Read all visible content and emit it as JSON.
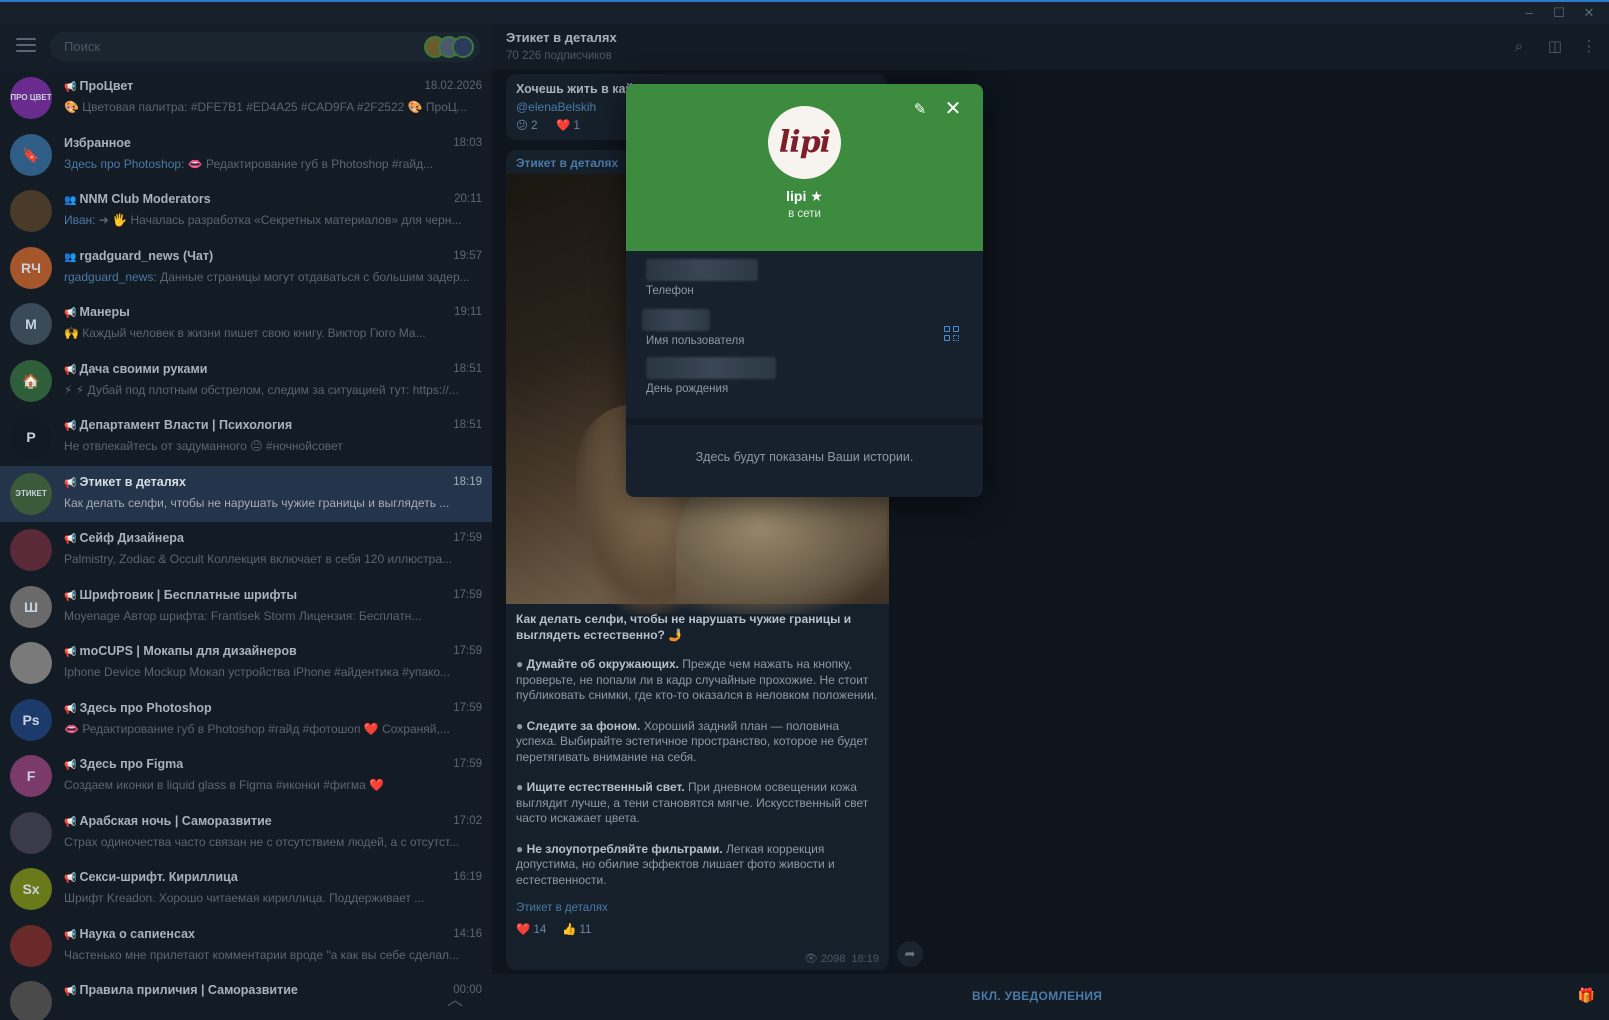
{
  "search": {
    "placeholder": "Поиск"
  },
  "chats": [
    {
      "name": "ПроЦвет",
      "time": "18.02.2026",
      "who": "",
      "preview": "🎨 Цветовая палитра: #DFE7B1 #ED4A25 #CAD9FA #2F2522 🎨 ПроЦ...",
      "avatar_text": "ПРО ЦВЕТ",
      "avatar_color": "#6a2b8e",
      "channel": true
    },
    {
      "name": "Избранное",
      "time": "18:03",
      "who": "Здесь про Photoshop:",
      "preview": " 👄 Редактирование губ в Photoshop #гайд...",
      "avatar_text": "🔖",
      "avatar_color": "#2f5d86",
      "channel": false
    },
    {
      "name": "NNM Club Moderators",
      "time": "20:11",
      "who": "Иван:",
      "preview": " ➜ 🖐 Началась разработка «Секретных материалов» для черн...",
      "avatar_text": "",
      "avatar_color": "#4a3a2a",
      "channel": false,
      "group": true
    },
    {
      "name": "rgadguard_news (Чат)",
      "time": "19:57",
      "who": "rgadguard_news:",
      "preview": " Данные страницы могут отдаваться с большим задер...",
      "avatar_text": "RЧ",
      "avatar_color": "#a5562a",
      "channel": false,
      "group": true
    },
    {
      "name": "Манеры",
      "time": "19:11",
      "who": "",
      "preview": "🙌 Каждый человек в жизни пишет свою книгу. Виктор Гюго Ма...",
      "avatar_text": "M",
      "avatar_color": "#3a4a58",
      "channel": true
    },
    {
      "name": "Дача своими руками",
      "time": "18:51",
      "who": "",
      "preview": "⚡ ⚡ Дубай под плотным обстрелом, следим за ситуацией тут: https://...",
      "avatar_text": "🏠",
      "avatar_color": "#2e5e3a",
      "channel": true
    },
    {
      "name": "Департамент Власти | Психология",
      "time": "18:51",
      "who": "",
      "preview": "Не отвлекайтесь от задуманного 😐 #ночнойсовет",
      "avatar_text": "P",
      "avatar_color": "#111a22",
      "channel": true
    },
    {
      "name": "Этикет в деталях",
      "time": "18:19",
      "who": "",
      "preview": "Как делать селфи, чтобы не нарушать чужие границы и выглядеть ...",
      "avatar_text": "ЭТИКЕТ",
      "avatar_color": "#3a5a3a",
      "channel": true,
      "active": true
    },
    {
      "name": "Сейф Дизайнера",
      "time": "17:59",
      "who": "",
      "preview": "Palmistry, Zodiac & Occult Коллекция включает в себя 120 иллюстра...",
      "avatar_text": "",
      "avatar_color": "#5a2a38",
      "channel": true
    },
    {
      "name": "Шрифтовик | Бесплатные шрифты",
      "time": "17:59",
      "who": "",
      "preview": "Moyenage Автор шрифта: Frantisek Storm Лицензия: Бесплатн...",
      "avatar_text": "Ш",
      "avatar_color": "#6a6a6a",
      "channel": true
    },
    {
      "name": "moCUPS | Мокапы для дизайнеров",
      "time": "17:59",
      "who": "",
      "preview": "Iphone Device Mockup Мокап устройства iPhone #айдентика #упако...",
      "avatar_text": "",
      "avatar_color": "#7a7a7a",
      "channel": true
    },
    {
      "name": "Здесь про Photoshop",
      "time": "17:59",
      "who": "",
      "preview": "👄 Редактирование губ в Photoshop #гайд #фотошоп ❤️ Сохраняй,...",
      "avatar_text": "Ps",
      "avatar_color": "#1c3a6a",
      "channel": true
    },
    {
      "name": "Здесь про Figma",
      "time": "17:59",
      "who": "",
      "preview": "Создаем иконки в liquid glass в Figma #иконки #фигма ❤️",
      "avatar_text": "F",
      "avatar_color": "#7a3a6a",
      "channel": true
    },
    {
      "name": "Арабская ночь | Саморазвитие",
      "time": "17:02",
      "who": "",
      "preview": "Страх одиночества часто связан не с отсутствием людей, а с отсутст...",
      "avatar_text": "",
      "avatar_color": "#3a3a4a",
      "channel": true,
      "prefix": "A"
    },
    {
      "name": "Секси-шрифт. Кириллица",
      "time": "16:19",
      "who": "",
      "preview": "Шрифт Kreadon. Хорошо читаемая кириллица. Поддерживает ...",
      "avatar_text": "Sx",
      "avatar_color": "#6a7a1a",
      "channel": true
    },
    {
      "name": "Наука о сапиенсах",
      "time": "14:16",
      "who": "",
      "preview": "Частенько мне прилетают комментарии вроде \"а как вы себе сделал...",
      "avatar_text": "",
      "avatar_color": "#6a2a2a",
      "channel": true
    },
    {
      "name": "Правила приличия | Саморазвитие",
      "time": "00:00",
      "who": "",
      "preview": "",
      "avatar_text": "",
      "avatar_color": "#4a4a4a",
      "channel": true
    }
  ],
  "main": {
    "title": "Этикет в деталях",
    "subscribers": "70 226 подписчиков",
    "top_message": {
      "title": "Хочешь жить в кай",
      "mention": "@elenaBelskih",
      "r1": "😕 2",
      "r2": "❤️ 1"
    },
    "post": {
      "source": "Этикет в деталях",
      "heading": "Как делать селфи, чтобы не нарушать чужие границы и выглядеть естественно? 🤳",
      "points": [
        {
          "bold": "Думайте об окружающих.",
          "text": " Прежде чем нажать на кнопку, проверьте, не попали ли в кадр случайные прохожие. Не стоит публиковать снимки, где кто-то оказался в неловком положении."
        },
        {
          "bold": "Следите за фоном.",
          "text": " Хороший задний план — половина успеха. Выбирайте эстетичное пространство, которое не будет перетягивать внимание на себя."
        },
        {
          "bold": "Ищите естественный свет.",
          "text": " При дневном освещении кожа выглядит лучше, а тени становятся мягче. Искусственный свет часто искажает цвета."
        },
        {
          "bold": "Не злоупотребляйте фильтрами.",
          "text": " Легкая коррекция допустима, но обилие эффектов лишает фото живости и естественности."
        }
      ],
      "footer_source": "Этикет в деталях",
      "likes": "❤️ 14",
      "thumbs": "👍 11",
      "views": "2098",
      "time": "18:19"
    },
    "notifications_label": "ВКЛ. УВЕДОМЛЕНИЯ"
  },
  "modal": {
    "avatar_logo": "lipi",
    "name": "lipi",
    "status": "в сети",
    "phone_label": "Телефон",
    "username_label": "Имя пользователя",
    "birthday_label": "День рождения",
    "stories_text": "Здесь будут показаны Ваши истории.",
    "header_color": "#3d8b3f"
  }
}
